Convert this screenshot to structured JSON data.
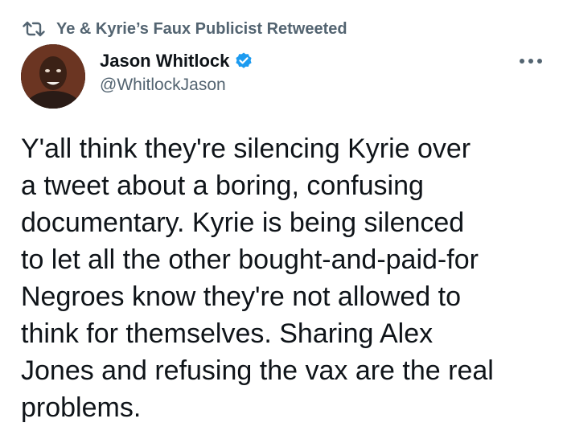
{
  "retweet": {
    "icon": "retweet-icon",
    "label": "Ye & Kyrie’s Faux Publicist Retweeted"
  },
  "author": {
    "display_name": "Jason Whitlock",
    "handle": "@WhitlockJason",
    "verified_icon": "verified-badge-icon",
    "avatar_icon": "avatar"
  },
  "menu": {
    "icon": "more-options-icon"
  },
  "tweet": {
    "text": "Y'all think they're silencing Kyrie over\na tweet about a boring, confusing\ndocumentary. Kyrie is being silenced\nto let all the other bought-and-paid-for\nNegroes know they're not allowed to\nthink for themselves. Sharing Alex\nJones and refusing the vax are the real\nproblems."
  },
  "colors": {
    "text_primary": "#0f1419",
    "text_secondary": "#536471",
    "verified_blue": "#1d9bf0",
    "background": "#ffffff"
  }
}
